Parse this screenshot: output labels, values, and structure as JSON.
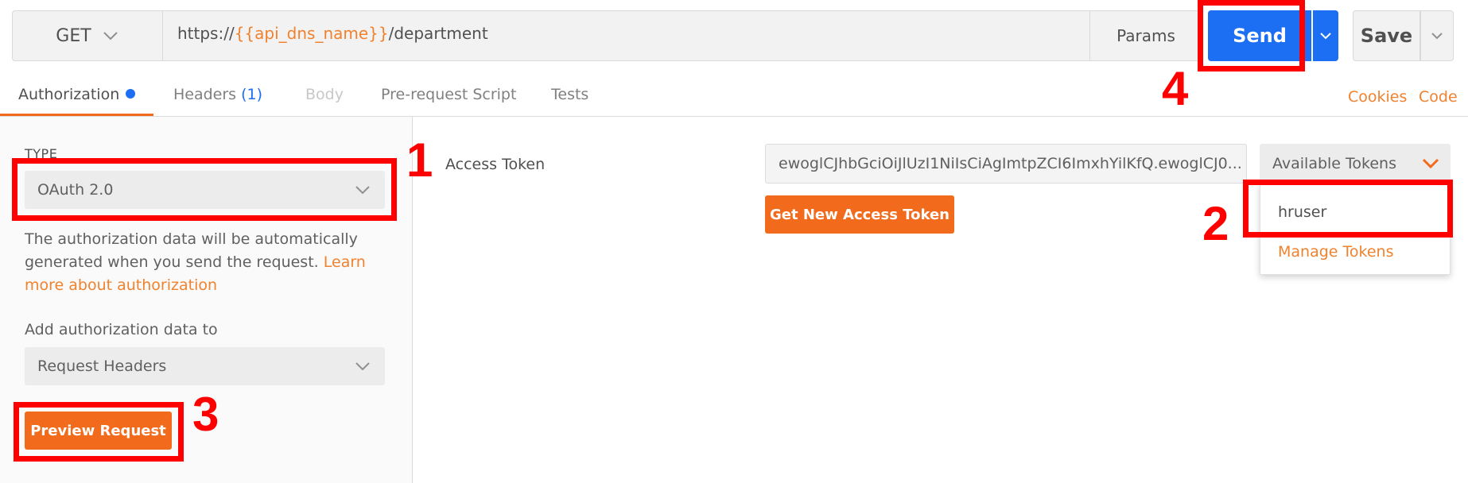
{
  "request": {
    "method": "GET",
    "url_prefix": "https://",
    "url_variable": "{{api_dns_name}}",
    "url_suffix": "/department",
    "params_label": "Params",
    "send_label": "Send",
    "save_label": "Save"
  },
  "tabs": [
    {
      "label": "Authorization",
      "active": true
    },
    {
      "label": "Headers",
      "count": "(1)"
    },
    {
      "label": "Body",
      "disabled": true
    },
    {
      "label": "Pre-request Script"
    },
    {
      "label": "Tests"
    }
  ],
  "links": {
    "cookies": "Cookies",
    "code": "Code"
  },
  "auth": {
    "type_label": "TYPE",
    "type_value": "OAuth 2.0",
    "help_text": "The authorization data will be automatically generated when you send the request.",
    "help_link": "Learn more about authorization",
    "add_to_label": "Add authorization data to",
    "add_to_value": "Request Headers",
    "preview_label": "Preview Request"
  },
  "token": {
    "label": "Access Token",
    "value": "ewoglCJhbGciOiJlUzI1NiIsCiAgImtpZCI6ImxhYilKfQ.ewoglCJ0...",
    "available_label": "Available Tokens",
    "get_new_label": "Get New Access Token",
    "menu_items": [
      "hruser",
      "Manage Tokens"
    ]
  },
  "annotations": [
    "1",
    "2",
    "3",
    "4"
  ],
  "colors": {
    "accent_orange": "#f26b1d",
    "send_blue": "#1c6ef2",
    "annotation_red": "#ff0000"
  }
}
